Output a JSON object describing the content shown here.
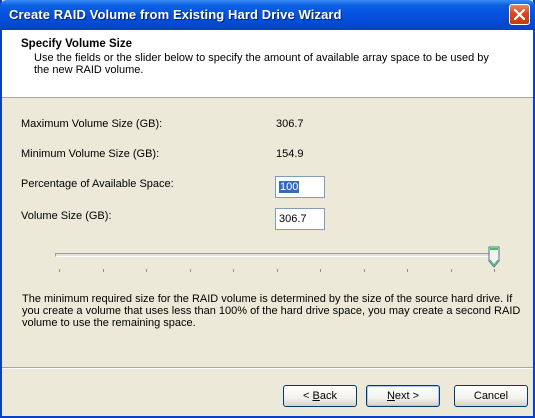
{
  "window": {
    "title": "Create RAID Volume from Existing Hard Drive Wizard"
  },
  "header": {
    "title": "Specify Volume Size",
    "description": "Use the fields or the slider below to specify the amount of available array space to be used by the new RAID volume."
  },
  "fields": {
    "max_label": "Maximum Volume Size (GB):",
    "max_value": "306.7",
    "min_label": "Minimum Volume Size (GB):",
    "min_value": "154.9",
    "percentage_label": "Percentage of Available Space:",
    "percentage_value": "100",
    "volume_label": "Volume Size (GB):",
    "volume_value": "306.7"
  },
  "slider": {
    "value_percent": 100,
    "tick_count": 11
  },
  "info_text": "The minimum required size for the RAID volume is determined by the size of the source hard drive. If you create a volume that uses less than 100% of the hard drive space, you may create a second RAID volume to use the remaining space.",
  "buttons": {
    "back_prefix": "< ",
    "back_key": "B",
    "back_rest": "ack",
    "next_key": "N",
    "next_rest": "ext >",
    "cancel": "Cancel"
  },
  "colors": {
    "titlebar": "#0551e0",
    "selection": "#316ac5",
    "dialog_face": "#ece9d8"
  },
  "icons": {
    "close": "close-icon",
    "slider_thumb": "slider-thumb-icon"
  }
}
